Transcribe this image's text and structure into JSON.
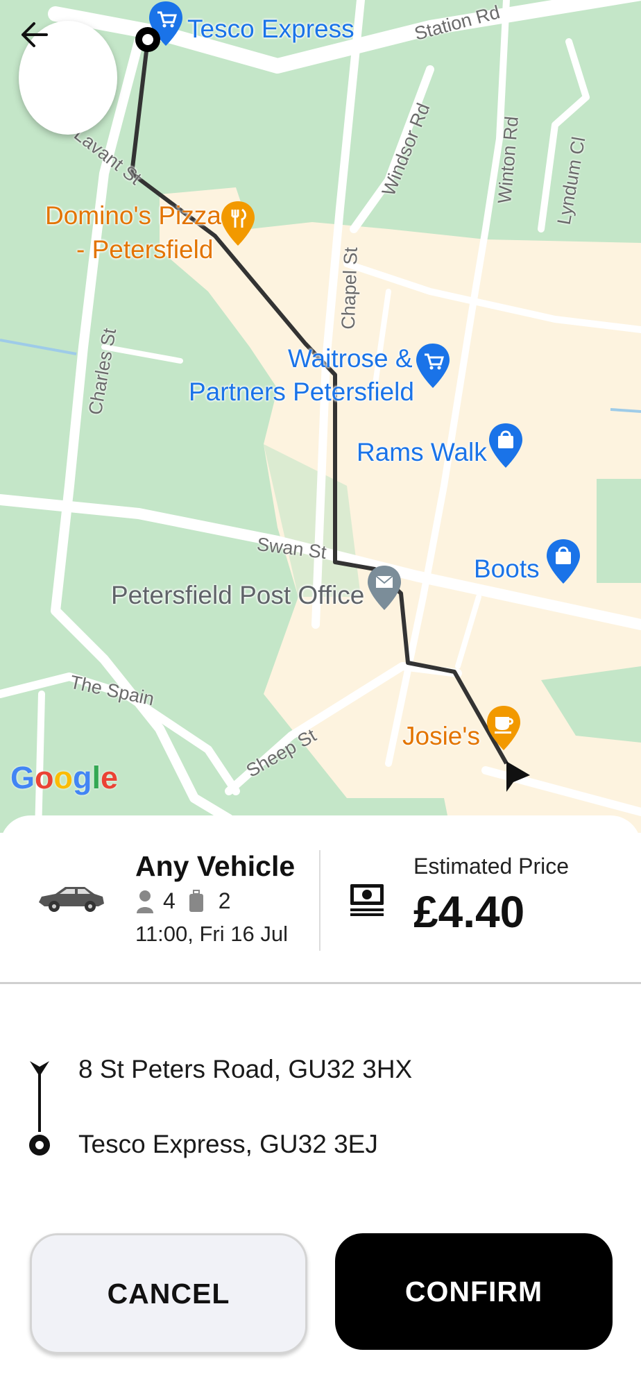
{
  "map": {
    "streets": [
      "Station Rd",
      "Lavant St",
      "Windsor Rd",
      "Winton Rd",
      "Lyndum Cl",
      "Chapel St",
      "Charles St",
      "Swan St",
      "The Spain",
      "Sheep St"
    ],
    "pois": [
      {
        "name": "Tesco Express",
        "icon": "shopping-cart-icon",
        "color": "#1a73e8"
      },
      {
        "name_line1": "Domino's Pizza",
        "name_line2": "- Petersfield",
        "icon": "restaurant-icon",
        "color": "#e37400"
      },
      {
        "name_line1": "Waitrose &",
        "name_line2": "Partners Petersfield",
        "icon": "shopping-cart-icon",
        "color": "#1a73e8"
      },
      {
        "name": "Rams Walk",
        "icon": "shopping-bag-icon",
        "color": "#1a73e8"
      },
      {
        "name": "Boots",
        "icon": "shopping-bag-icon",
        "color": "#1a73e8"
      },
      {
        "name": "Petersfield Post Office",
        "icon": "mail-icon",
        "color": "#7b8d99"
      },
      {
        "name": "Josie's",
        "icon": "cafe-icon",
        "color": "#e37400"
      }
    ],
    "google_logo": "Google",
    "back_icon": "arrow-left-icon"
  },
  "vehicle": {
    "title": "Any Vehicle",
    "passengers": "4",
    "luggage": "2",
    "time": "11:00, Fri 16 Jul",
    "icon": "car-icon"
  },
  "price": {
    "label": "Estimated Price",
    "value": "£4.40",
    "icon": "cash-icon"
  },
  "route": {
    "pickup": "8 St Peters Road, GU32 3HX",
    "dropoff": "Tesco Express, GU32 3EJ"
  },
  "actions": {
    "cancel": "CANCEL",
    "confirm": "CONFIRM"
  },
  "colors": {
    "park_green": "#c4e6c8",
    "town_beige": "#fdf3df",
    "route": "#333333",
    "confirm_bg": "#000000",
    "cancel_bg": "#f1f2f7"
  }
}
